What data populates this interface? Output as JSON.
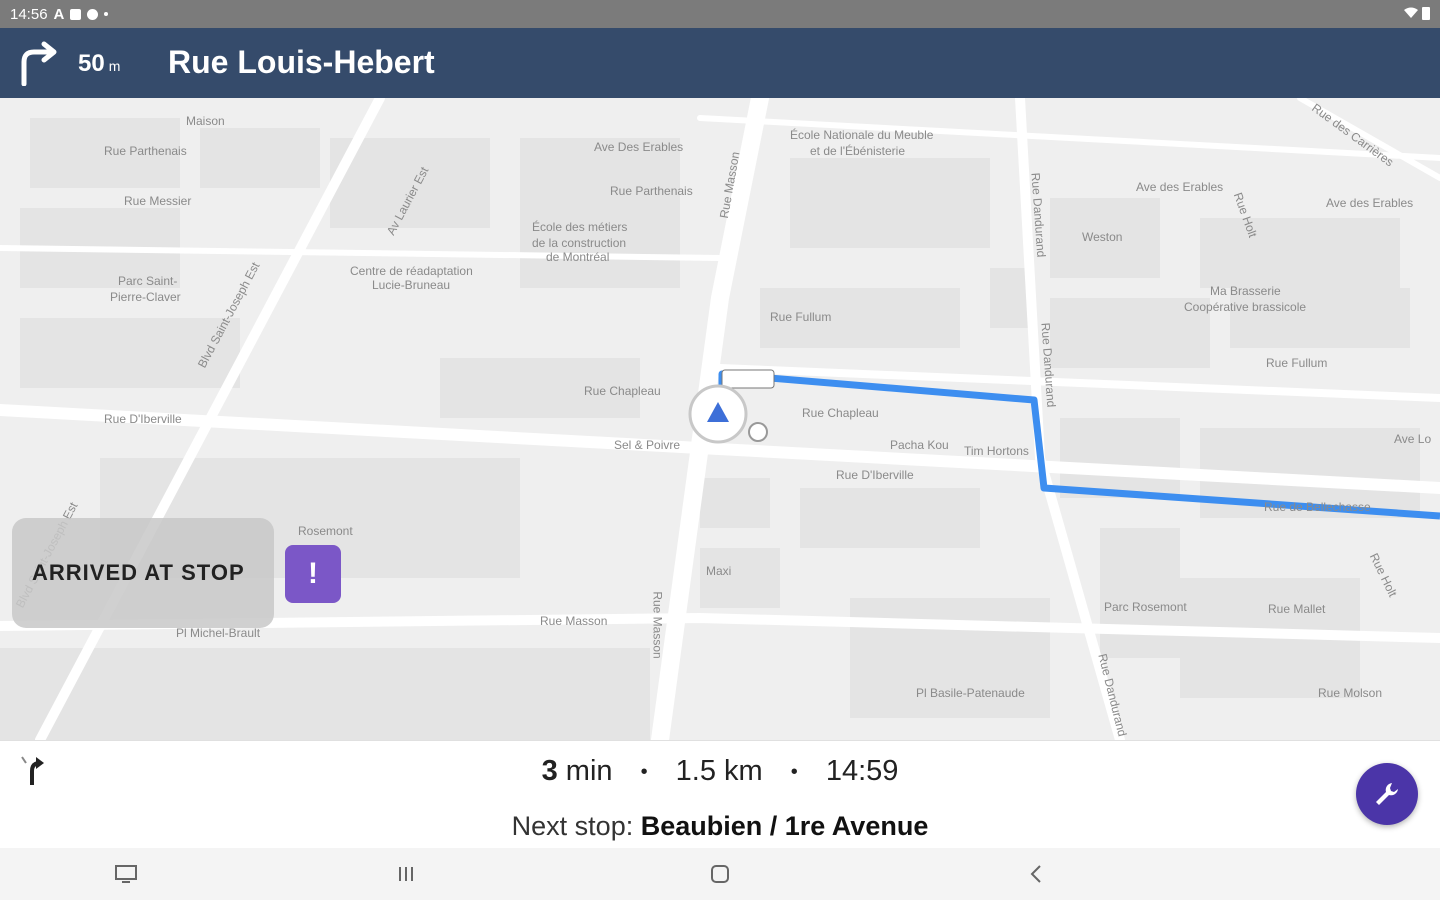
{
  "status_bar": {
    "time": "14:56",
    "letter": "A"
  },
  "header": {
    "distance": "50",
    "distance_unit": "m",
    "street": "Rue Louis-Hebert"
  },
  "map": {
    "labels": [
      "Maison",
      "Rue Parthenais",
      "Rue Messier",
      "Parc Saint-",
      "Pierre-Claver",
      "Blvd Saint-Joseph Est",
      "Av Laurier Est",
      "Centre de réadaptation",
      "Lucie-Bruneau",
      "Ave Des Erables",
      "Rue Parthenais",
      "École des métiers",
      "de la construction",
      "de Montréal",
      "Rue Masson",
      "École Nationale du Meuble",
      "et de l'Ébénisterie",
      "Rue Fullum",
      "Rue Chapleau",
      "Rue Chapleau",
      "Sel & Poivre",
      "Rue D'Iberville",
      "Rue D'Iberville",
      "Pacha Kou",
      "Tim Hortons",
      "Rue Dandurand",
      "Rue Dandurand",
      "Weston",
      "Ave des Erables",
      "Ave des Erables",
      "Ma Brasserie",
      "Coopérative brassicole",
      "Rue Fullum",
      "Ave Lo",
      "Rue de Bellechasse",
      "Maxi",
      "Rue Masson",
      "Rue Masson",
      "Rosemont",
      "Parc Rosemont",
      "Rue Mallet",
      "Pl Basile-Patenaude",
      "Rue Molson",
      "Pl Michel-Brault",
      "Blvd Saint-Joseph Est",
      "Rue Dandurand",
      "Rue Holt",
      "Rue Holt",
      "Rue des Carrières"
    ]
  },
  "arrived_button": {
    "label": "ARRIVED AT STOP"
  },
  "alert_button": {
    "label": "!"
  },
  "trip": {
    "minutes_value": "3",
    "minutes_unit": "min",
    "distance": "1.5 km",
    "arrival_time": "14:59",
    "separator": "•",
    "next_stop_prefix": "Next stop:",
    "next_stop_name": "Beaubien / 1re Avenue"
  },
  "colors": {
    "header_bg": "#354b6b",
    "route": "#3d8ef0",
    "accent_purple": "#7b57c7",
    "fab": "#4b35a8"
  },
  "icons": {
    "turn": "turn-right-icon",
    "small_turn": "next-turn-icon",
    "fab": "wrench-icon",
    "location": "navigation-arrow-icon",
    "sys_nav": [
      "keyboard-icon",
      "recents-icon",
      "home-icon",
      "back-icon"
    ]
  }
}
